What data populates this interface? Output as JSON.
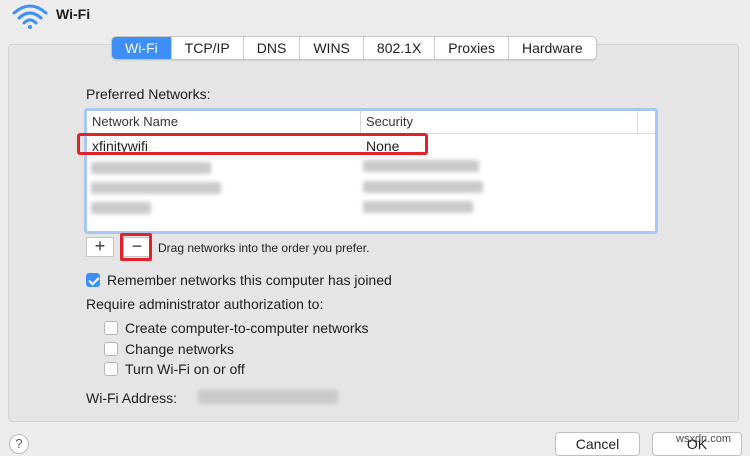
{
  "window": {
    "title": "Wi-Fi"
  },
  "tabs": [
    {
      "label": "Wi-Fi",
      "active": true
    },
    {
      "label": "TCP/IP",
      "active": false
    },
    {
      "label": "DNS",
      "active": false
    },
    {
      "label": "WINS",
      "active": false
    },
    {
      "label": "802.1X",
      "active": false
    },
    {
      "label": "Proxies",
      "active": false
    },
    {
      "label": "Hardware",
      "active": false
    }
  ],
  "preferred": {
    "label": "Preferred Networks:",
    "columns": {
      "name": "Network Name",
      "security": "Security"
    },
    "rows": [
      {
        "name": "xfinitywifi",
        "security": "None",
        "highlighted": true
      }
    ],
    "add_label": "+",
    "remove_label": "−",
    "hint": "Drag networks into the order you prefer."
  },
  "options": {
    "remember": {
      "label": "Remember networks this computer has joined",
      "checked": true
    },
    "require_label": "Require administrator authorization to:",
    "auth": [
      {
        "label": "Create computer-to-computer networks",
        "checked": false
      },
      {
        "label": "Change networks",
        "checked": false
      },
      {
        "label": "Turn Wi-Fi on or off",
        "checked": false
      }
    ]
  },
  "address": {
    "label": "Wi-Fi Address:"
  },
  "buttons": {
    "help": "?",
    "cancel": "Cancel",
    "ok": "OK"
  },
  "watermark": "wsxdn.com",
  "colors": {
    "accent": "#3d8ff7",
    "highlight": "#e0232a",
    "table_focus": "#a7c8f0"
  },
  "icons": {
    "title": "wifi-icon",
    "remember_checkbox": "checkmark-icon"
  }
}
